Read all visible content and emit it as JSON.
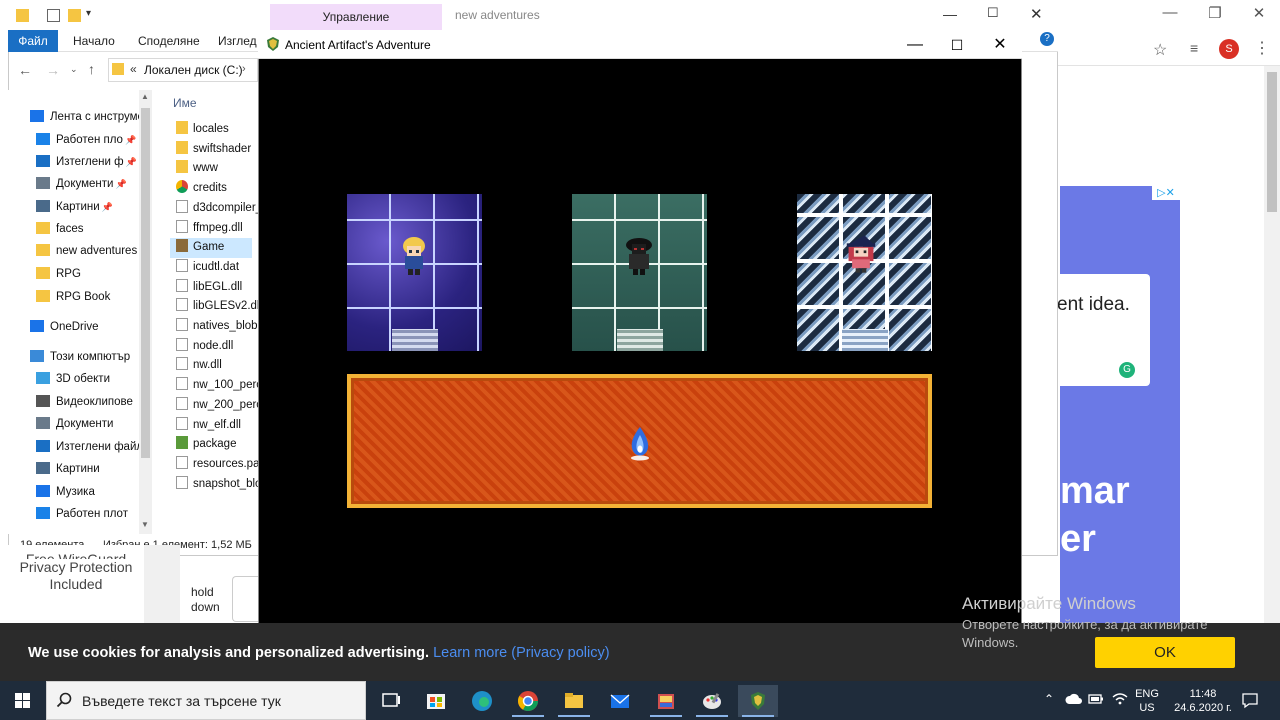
{
  "explorer": {
    "contextual_tab": "Управление",
    "window_title": "new adventures",
    "ribbon_tabs": [
      "Файл",
      "Начало",
      "Споделяне",
      "Изглед"
    ],
    "address_prefix": "«",
    "address_path": "Локален диск (C:)",
    "column_header": "Име",
    "nav_items": [
      {
        "label": "Лента с инструме",
        "icon": "star-icon",
        "color": "#1a73e8"
      },
      {
        "label": "Работен пло",
        "icon": "desktop-icon",
        "color": "#1a82e8",
        "pinned": true
      },
      {
        "label": "Изтеглени ф",
        "icon": "download-icon",
        "color": "#1a6fc4",
        "pinned": true
      },
      {
        "label": "Документи",
        "icon": "document-icon",
        "color": "#6a7a8a",
        "pinned": true
      },
      {
        "label": "Картини",
        "icon": "pictures-icon",
        "color": "#4a6a8a",
        "pinned": true
      },
      {
        "label": "faces",
        "icon": "folder-icon",
        "color": "#f5c542"
      },
      {
        "label": "new adventures",
        "icon": "folder-icon",
        "color": "#f5c542"
      },
      {
        "label": "RPG",
        "icon": "folder-icon",
        "color": "#f5c542"
      },
      {
        "label": "RPG Book",
        "icon": "folder-icon",
        "color": "#f5c542"
      },
      {
        "label": "OneDrive",
        "icon": "cloud-icon",
        "color": "#1a73e8"
      },
      {
        "label": "Този компютър",
        "icon": "computer-icon",
        "color": "#3a8ad8"
      },
      {
        "label": "3D обекти",
        "icon": "cube-icon",
        "color": "#3aa0e0"
      },
      {
        "label": "Видеоклипове",
        "icon": "video-icon",
        "color": "#555"
      },
      {
        "label": "Документи",
        "icon": "document-icon",
        "color": "#6a7a8a"
      },
      {
        "label": "Изтеглени файл",
        "icon": "download-icon",
        "color": "#1a6fc4"
      },
      {
        "label": "Картини",
        "icon": "pictures-icon",
        "color": "#4a6a8a"
      },
      {
        "label": "Музика",
        "icon": "music-icon",
        "color": "#1a73e8"
      },
      {
        "label": "Работен плот",
        "icon": "desktop-icon",
        "color": "#1a82e8"
      }
    ],
    "files": [
      {
        "name": "locales",
        "icon": "folder-icon",
        "color": "#f5c542"
      },
      {
        "name": "swiftshader",
        "icon": "folder-icon",
        "color": "#f5c542"
      },
      {
        "name": "www",
        "icon": "folder-icon",
        "color": "#f5c542"
      },
      {
        "name": "credits",
        "icon": "chrome-icon",
        "color": "#db4437"
      },
      {
        "name": "d3dcompiler_",
        "icon": "file-icon",
        "color": "#999"
      },
      {
        "name": "ffmpeg.dll",
        "icon": "file-icon",
        "color": "#999"
      },
      {
        "name": "Game",
        "icon": "game-icon",
        "color": "#8a6a3a",
        "selected": true
      },
      {
        "name": "icudtl.dat",
        "icon": "file-icon",
        "color": "#999"
      },
      {
        "name": "libEGL.dll",
        "icon": "file-icon",
        "color": "#999"
      },
      {
        "name": "libGLESv2.dll",
        "icon": "file-icon",
        "color": "#999"
      },
      {
        "name": "natives_blob.",
        "icon": "file-icon",
        "color": "#999"
      },
      {
        "name": "node.dll",
        "icon": "file-icon",
        "color": "#999"
      },
      {
        "name": "nw.dll",
        "icon": "file-icon",
        "color": "#999"
      },
      {
        "name": "nw_100_perc",
        "icon": "file-icon",
        "color": "#999"
      },
      {
        "name": "nw_200_perc",
        "icon": "file-icon",
        "color": "#999"
      },
      {
        "name": "nw_elf.dll",
        "icon": "file-icon",
        "color": "#999"
      },
      {
        "name": "package",
        "icon": "package-icon",
        "color": "#5a9a3a"
      },
      {
        "name": "resources.pal",
        "icon": "file-icon",
        "color": "#999"
      },
      {
        "name": "snapshot_blo",
        "icon": "file-icon",
        "color": "#999"
      }
    ],
    "status_count": "19 елемента",
    "status_selection": "Избран е 1 елемент: 1,52 МБ"
  },
  "game": {
    "title": "Ancient Artifact's Adventure",
    "rooms": [
      {
        "theme": "cosmic",
        "character": "blonde-hero-sprite"
      },
      {
        "theme": "jade",
        "character": "dark-hooded-sprite"
      },
      {
        "theme": "ice",
        "character": "red-haired-witch-sprite"
      }
    ],
    "floor": "lava-carpet",
    "player": "blue-flame-sprite"
  },
  "browser": {
    "avatar_letter": "S",
    "ad_card_text": "ent idea.",
    "ad_big_1": "mar",
    "ad_big_2": "er",
    "ad_close": "▷✕"
  },
  "left_under": {
    "privacy_text_1": "Free WireGuard",
    "privacy_text_2": "Privacy Protection",
    "privacy_text_3": "Included",
    "hold_1": "hold",
    "hold_2": "down"
  },
  "cookie": {
    "text": "We use cookies for analysis and personalized advertising.",
    "link": "Learn more (Privacy policy)",
    "ok": "OK"
  },
  "watermark": {
    "title": "Активирайте Windows",
    "subtitle": "Отворете настройките, за да активирате Windows."
  },
  "taskbar": {
    "search_placeholder": "Въведете текст за търсене тук",
    "lang_1": "ENG",
    "lang_2": "US",
    "time": "11:48",
    "date": "24.6.2020 г."
  }
}
